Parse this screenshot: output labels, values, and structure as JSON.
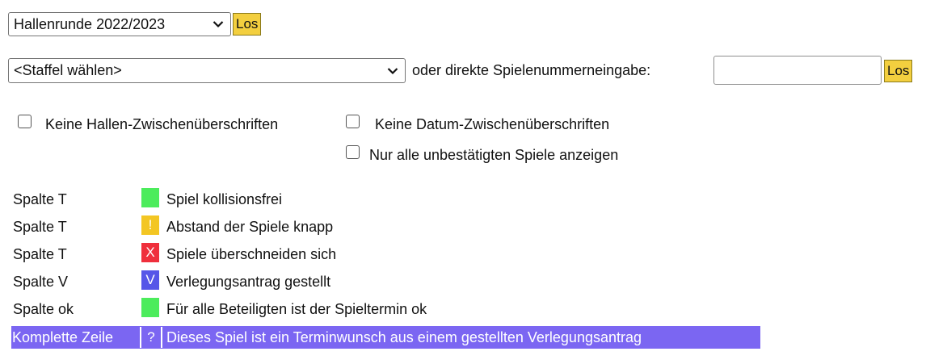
{
  "season_select": {
    "value": "Hallenrunde 2022/2023"
  },
  "season_go": {
    "label": "Los"
  },
  "staffel_select": {
    "value": "<Staffel wählen>"
  },
  "direct_input_label": "oder direkte Spielenummerneingabe:",
  "game_number_input": {
    "value": "",
    "placeholder": ""
  },
  "game_number_go": {
    "label": "Los"
  },
  "options": {
    "no_hall_headers": "Keine Hallen-Zwischenüberschriften",
    "no_date_headers": "Keine Datum-Zwischenüberschriften",
    "only_unconfirmed": "Nur alle unbestätigten Spiele anzeigen"
  },
  "legend": [
    {
      "key": "Spalte T",
      "symbol": "",
      "color": "#4cec5c",
      "text": "Spiel kollisionsfrei"
    },
    {
      "key": "Spalte T",
      "symbol": "!",
      "color": "#f3c623",
      "text": "Abstand der Spiele knapp"
    },
    {
      "key": "Spalte T",
      "symbol": "X",
      "color": "#ef2f3c",
      "text": "Spiele überschneiden sich"
    },
    {
      "key": "Spalte V",
      "symbol": "V",
      "color": "#5656e8",
      "text": "Verlegungsantrag gestellt"
    },
    {
      "key": "Spalte ok",
      "symbol": "",
      "color": "#4cec5c",
      "text": "Für alle Beteiligten ist der Spieltermin ok"
    },
    {
      "key": "Komplette Zeile",
      "symbol": "?",
      "color": "#7b66f2",
      "text": "Dieses Spiel ist ein Terminwunsch aus einem gestellten Verlegungsantrag"
    }
  ]
}
